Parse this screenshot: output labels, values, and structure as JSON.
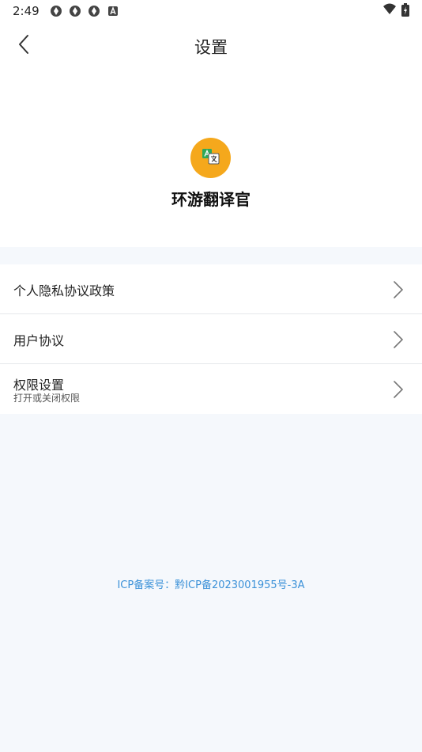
{
  "status_bar": {
    "time": "2:49",
    "left_icons": [
      "sync-icon",
      "sync-icon",
      "sync-icon",
      "text-a-icon"
    ],
    "right_icons": [
      "wifi-icon",
      "battery-charging-icon"
    ]
  },
  "app_bar": {
    "title": "设置",
    "back_icon": "chevron-left-icon"
  },
  "hero": {
    "logo_icon": "translate-icon",
    "logo_color": "#f5a81c",
    "app_name": "环游翻译官"
  },
  "menu": {
    "items": [
      {
        "label": "个人隐私协议政策",
        "subtitle": ""
      },
      {
        "label": "用户协议",
        "subtitle": ""
      },
      {
        "label": "权限设置",
        "subtitle": "打开或关闭权限"
      }
    ]
  },
  "footer": {
    "icp_text": "ICP备案号：黔ICP备2023001955号-3A",
    "icp_color": "#3b91d8"
  }
}
